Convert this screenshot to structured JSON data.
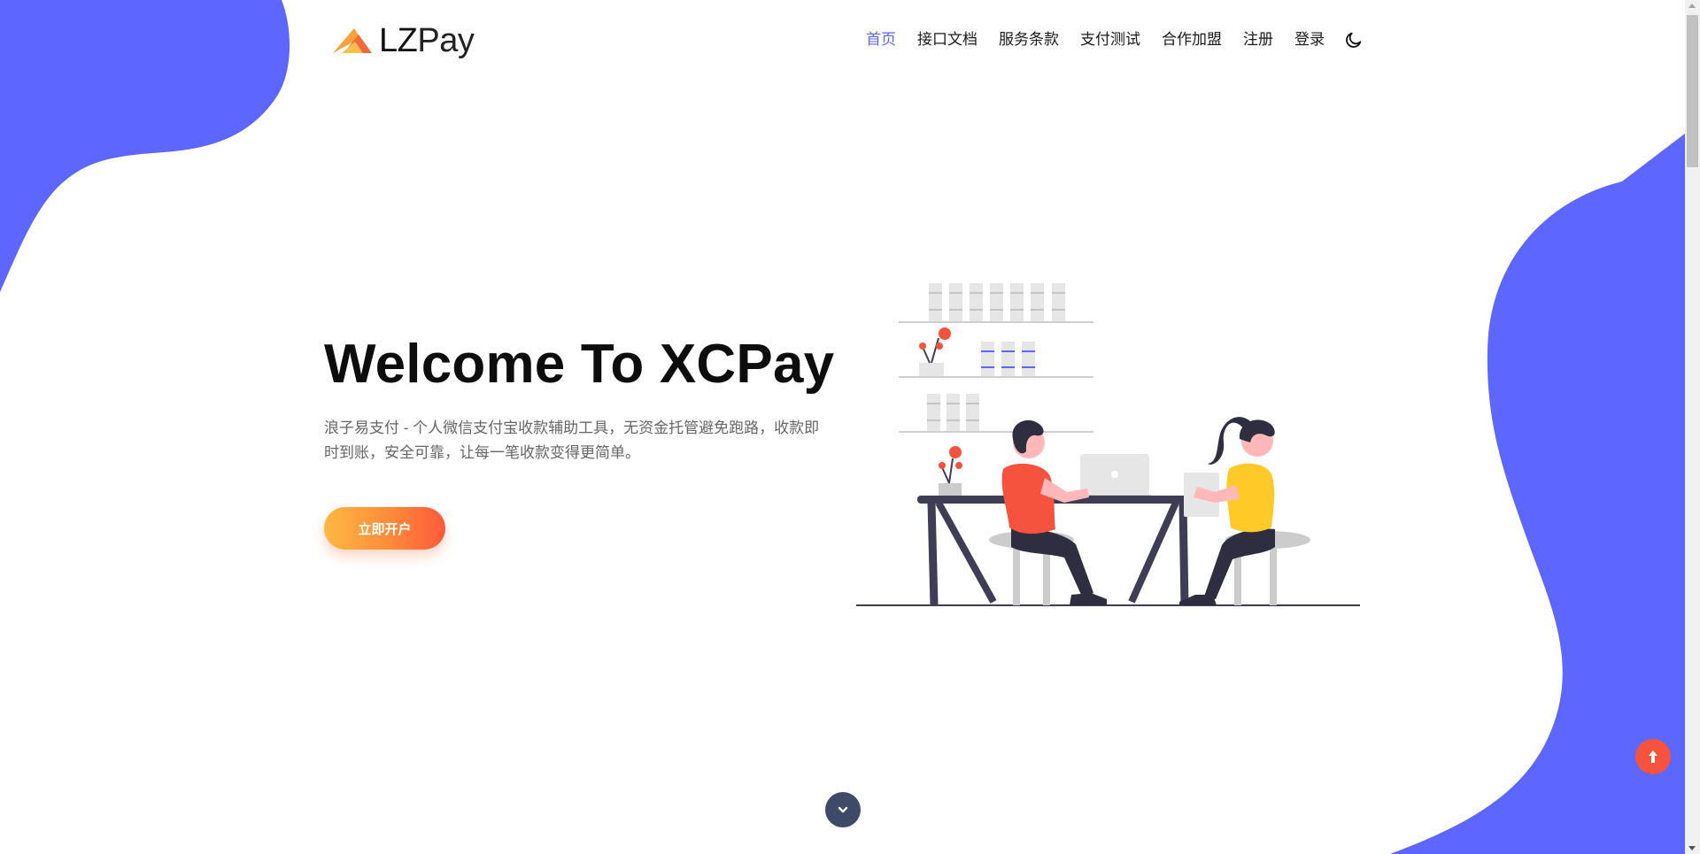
{
  "brand": {
    "logo_text_lz": "LZ",
    "logo_text_pay": "Pay",
    "accent": "#5d66fe",
    "blob_color": "#5d66fe"
  },
  "nav": {
    "items": [
      {
        "label": "首页",
        "active": true
      },
      {
        "label": "接口文档",
        "active": false
      },
      {
        "label": "服务条款",
        "active": false
      },
      {
        "label": "支付测试",
        "active": false
      },
      {
        "label": "合作加盟",
        "active": false
      },
      {
        "label": "注册",
        "active": false
      },
      {
        "label": "登录",
        "active": false
      }
    ],
    "theme_icon": "moon-icon"
  },
  "hero": {
    "title": "Welcome To XCPay",
    "description": "浪子易支付 - 个人微信支付宝收款辅助工具，无资金托管避免跑路，收款即时到账，安全可靠，让每一笔收款变得更简单。",
    "cta_label": "立即开户",
    "cta_gradient": [
      "#ffb843",
      "#fb5a3b"
    ]
  },
  "controls": {
    "scroll_down_icon": "chevron-down-icon",
    "back_to_top_icon": "arrow-up-icon",
    "scroll_down_color": "#3f4a68",
    "back_to_top_color": "#f5533d"
  }
}
